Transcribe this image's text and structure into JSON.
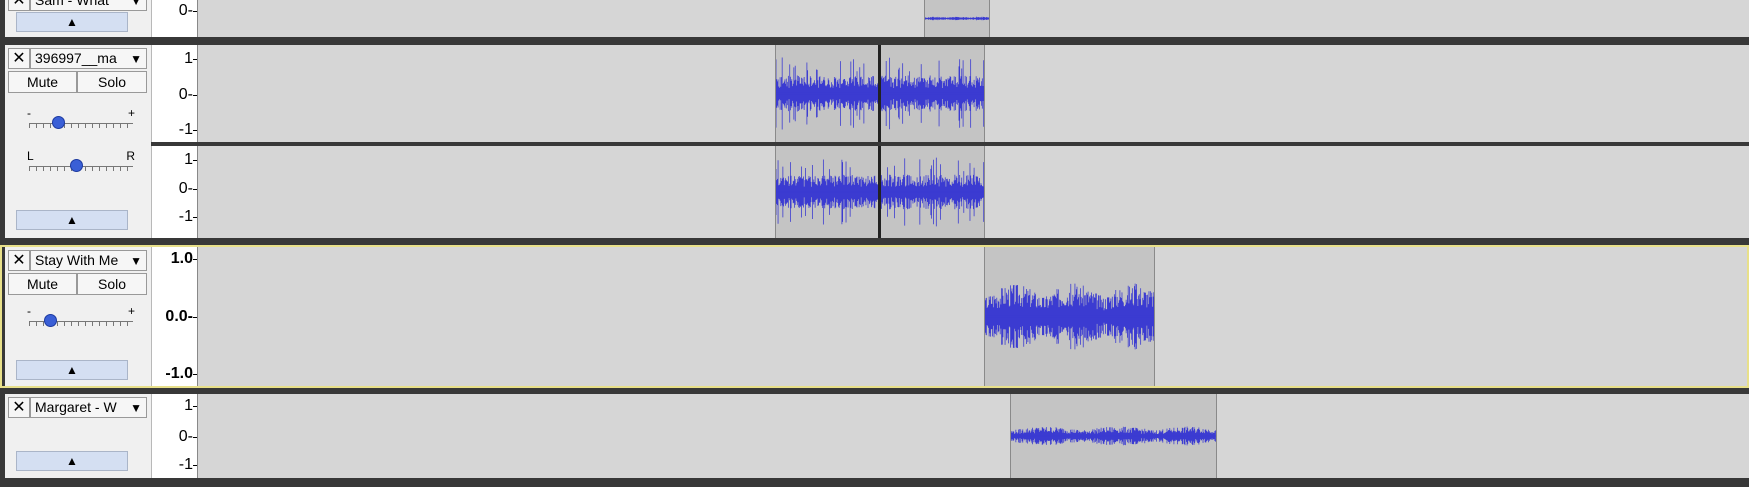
{
  "tracks": [
    {
      "name": "Sam - What",
      "close_glyph": "✕",
      "menu_glyph": "▼",
      "collapse_glyph": "▲",
      "scale": [
        "0-"
      ]
    },
    {
      "name": "396997__ma",
      "close_glyph": "✕",
      "menu_glyph": "▼",
      "collapse_glyph": "▲",
      "mute_label": "Mute",
      "solo_label": "Solo",
      "gain": {
        "min_label": "-",
        "max_label": "+",
        "level": 0.28
      },
      "pan": {
        "left_label": "L",
        "right_label": "R",
        "level": 0.45
      },
      "channels": [
        {
          "scale": [
            "1",
            "0-",
            "-1"
          ]
        },
        {
          "scale": [
            "1",
            "0-",
            "-1"
          ]
        }
      ]
    },
    {
      "name": "Stay With Me",
      "close_glyph": "✕",
      "menu_glyph": "▼",
      "collapse_glyph": "▲",
      "mute_label": "Mute",
      "solo_label": "Solo",
      "gain": {
        "min_label": "-",
        "max_label": "+",
        "level": 0.2
      },
      "scale": [
        "1.0",
        "0.0-",
        "-1.0"
      ],
      "selected": true
    },
    {
      "name": "Margaret - W",
      "close_glyph": "✕",
      "menu_glyph": "▼",
      "collapse_glyph": "▲",
      "scale": [
        "1",
        "0-",
        "-1"
      ]
    }
  ],
  "colors": {
    "waveform": "#3b3bd1",
    "background": "#d6d6d6",
    "clip": "#c4c4c4",
    "selected_border": "#e8e08a",
    "separator": "#383838",
    "knob": "#3a5fd6",
    "collapse_button": "#d4dff2"
  }
}
